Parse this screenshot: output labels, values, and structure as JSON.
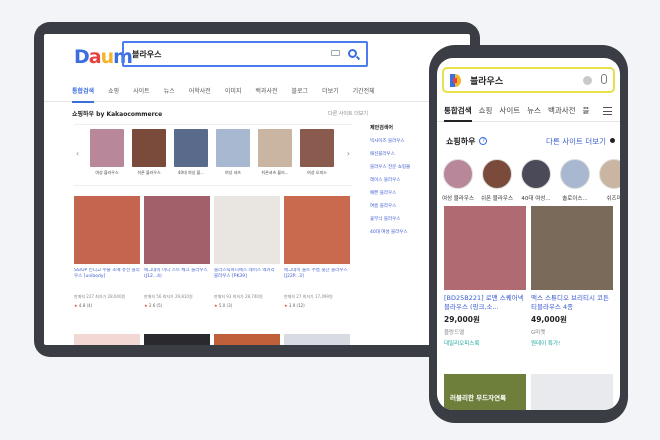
{
  "tablet": {
    "logo": "Daum",
    "search": {
      "value": "블라우스"
    },
    "tabs": [
      "통합검색",
      "쇼핑",
      "사이트",
      "뉴스",
      "어학사전",
      "이미지",
      "백과사전",
      "블로그",
      "더보기",
      "기간전체"
    ],
    "shopping_title": "쇼핑하우 by Kakaocommerce",
    "shopping_more": "다른 사이트 더보기",
    "categories": [
      "여성 블라우스",
      "쉬폰 블라우스",
      "40대 여성 블...",
      "여성 셔츠",
      "쉬폰셔츠 블라...",
      "여성 오피스"
    ],
    "side_title": "제안검색어",
    "side_links": [
      "빅사이즈 블라우스",
      "패션블라우스",
      "블라우스 전문 쇼핑몰",
      "레이스 블라우스",
      "예쁜 블라우스",
      "여름 블라우스",
      "꽃무늬 블라우스",
      "40대 여성 블라우스"
    ],
    "products": [
      {
        "title": "SS/UP 인디고 수술 소매 퓨전 블라우스 [unibody]",
        "meta": "판매처 227  최저가 28,040원",
        "rating": "4.8",
        "reviews": "(4)",
        "color": "#c4664f"
      },
      {
        "title": "에그데이 미니 스트 체크 블라우스 (J12...4)",
        "meta": "판매처 56  최저가 29,810원",
        "rating": "2.6",
        "reviews": "(5)",
        "color": "#a2606a"
      },
      {
        "title": "플라스틱파니에스 레이스 넥카라 블라우스 [PK39]",
        "meta": "판매처 93  최저가 28,740원",
        "rating": "5.0",
        "reviews": "(3)",
        "color": "#e9e6e2"
      },
      {
        "title": "에그데이 울트 주름 뒷단 블라우스 [J22P...3]",
        "meta": "판매처 27  최저가 17,499원",
        "rating": "3.9",
        "reviews": "(12)",
        "color": "#c96a4e"
      }
    ]
  },
  "phone": {
    "search": {
      "value": "블라우스"
    },
    "tabs": [
      "통합검색",
      "쇼핑",
      "사이트",
      "뉴스",
      "백과사전",
      "블"
    ],
    "section_title": "쇼핑하우",
    "section_help": "?",
    "section_more": "다른 사이트 더보기",
    "categories": [
      "여성 블라우스",
      "쉬폰 블라우스",
      "40대 여성...",
      "솔로이스...",
      "쉬즈미"
    ],
    "products": [
      {
        "title": "[BD25B221] 로맨 스퀘어넥 블라우스 (핑크,소...",
        "price": "29,000원",
        "shop": "블랑드엘",
        "badge": "데일리오피스룩",
        "color": "#b06a72"
      },
      {
        "title": "맥스 스튜디오 브리티시 코튼 티블라우스 4종",
        "price": "49,000원",
        "shop": "G마켓",
        "badge": "원데이 특가!",
        "color": "#7a6a5a"
      }
    ],
    "bottom_caption": "러블리한 무드자연룩"
  }
}
